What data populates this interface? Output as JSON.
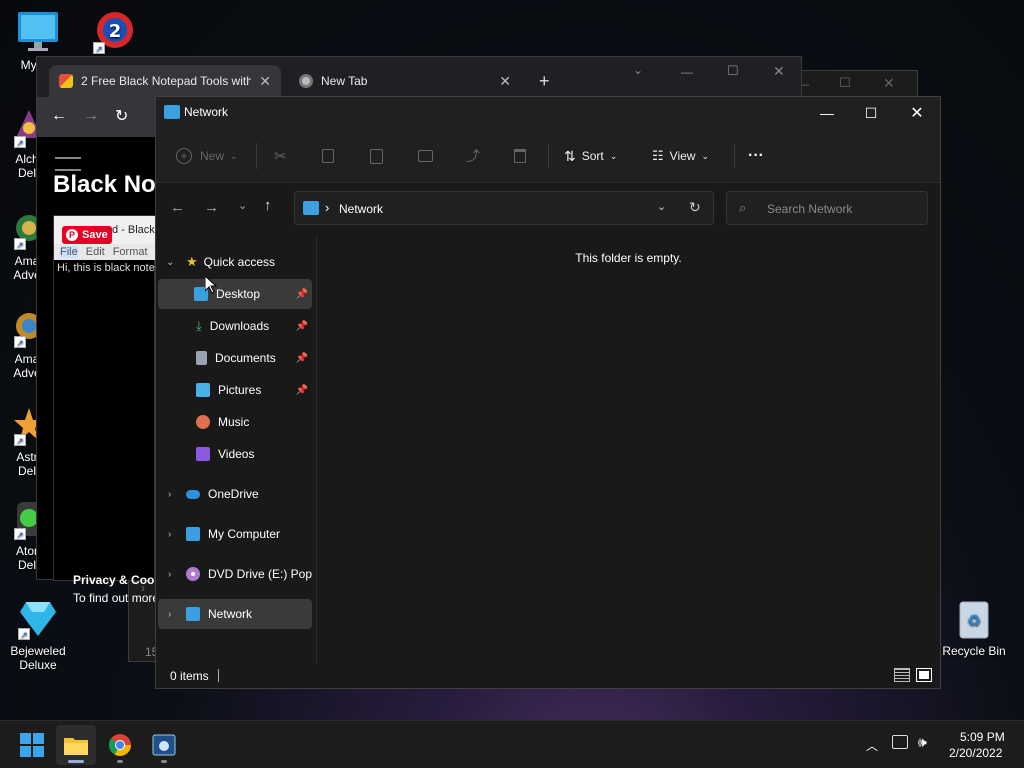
{
  "desktop": {
    "icons": [
      {
        "label": "My Co"
      },
      {
        "label": "Alch Del"
      },
      {
        "label": "Ama Adve"
      },
      {
        "label": "Ama Adve"
      },
      {
        "label": "Astr Del"
      },
      {
        "label": "Ator Del"
      },
      {
        "label": "Bejeweled Deluxe"
      },
      {
        "label": "Recycle Bin"
      }
    ]
  },
  "browser": {
    "tab1_title": "2 Free Black Notepad Tools with",
    "tab2_title": "New Tab",
    "new_tab": "+",
    "page_heading": "Black Not",
    "save_label": "Save",
    "inner_title": "d - Black",
    "menu_file": "File",
    "menu_edit": "Edit",
    "menu_format": "Format",
    "notepad_text": "Hi, this is black notep",
    "privacy_line1": "Privacy & Cooki",
    "privacy_line2": "To find out more",
    "peek_15": "15"
  },
  "explorer": {
    "title": "Network",
    "cmd": {
      "new_label": "New",
      "sort_label": "Sort",
      "view_label": "View",
      "more_label": "···"
    },
    "address": {
      "crumb": "Network",
      "sep": "›",
      "search_placeholder": "Search Network"
    },
    "nav": {
      "quick_access": "Quick access",
      "desktop": "Desktop",
      "downloads": "Downloads",
      "documents": "Documents",
      "pictures": "Pictures",
      "music": "Music",
      "videos": "Videos",
      "onedrive": "OneDrive",
      "my_computer": "My Computer",
      "dvd": "DVD Drive (E:) Popca",
      "network": "Network"
    },
    "empty_message": "This folder is empty.",
    "status_items": "0 items"
  },
  "taskbar": {
    "time": "5:09 PM",
    "date": "2/20/2022"
  }
}
